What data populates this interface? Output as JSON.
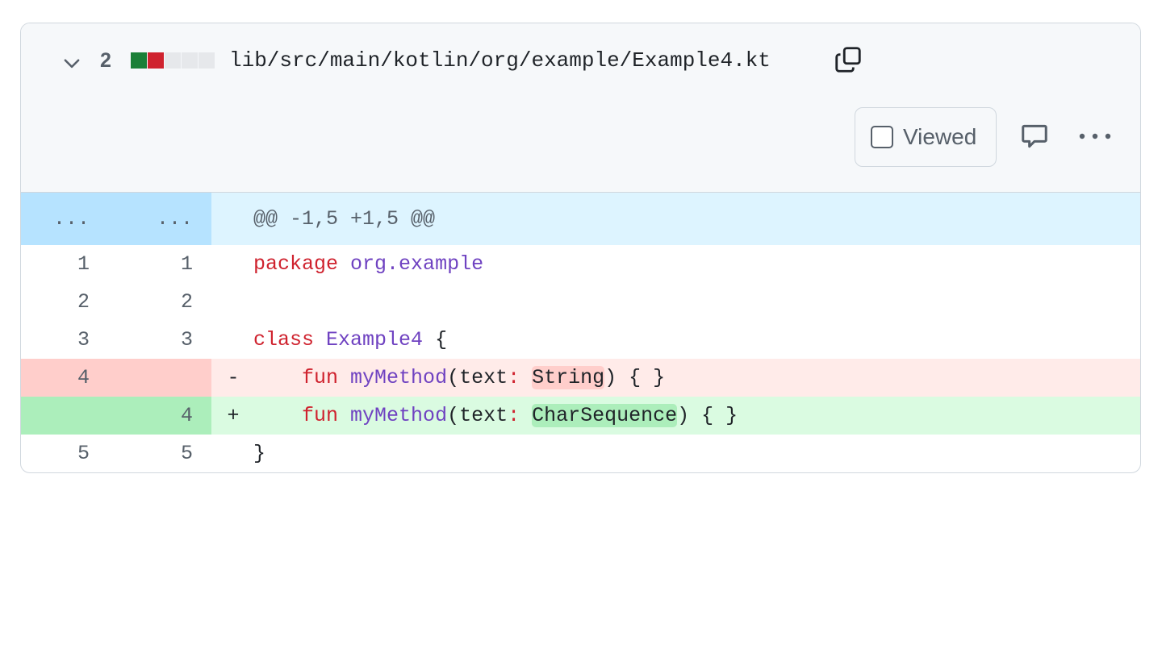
{
  "file_header": {
    "change_count": "2",
    "diffstat": [
      "add",
      "del",
      "neutral",
      "neutral",
      "neutral"
    ],
    "file_path": "lib/src/main/kotlin/org/example/Example4.kt",
    "viewed_label": "Viewed",
    "viewed_checked": false
  },
  "colors": {
    "added": "#1a7f37",
    "deleted": "#cf222e",
    "hunk_bg": "#ddf4ff",
    "keyword": "#cf222e",
    "entity": "#6f42c1"
  },
  "diff": {
    "hunk": {
      "old_ln": "...",
      "new_ln": "...",
      "header": "@@ -1,5 +1,5 @@"
    },
    "lines": [
      {
        "old": "1",
        "new": "1",
        "marker": "",
        "kw": "package",
        "sp": " ",
        "ent": "org.example",
        "rest": ""
      },
      {
        "old": "2",
        "new": "2",
        "marker": "",
        "kw": "",
        "sp": "",
        "ent": "",
        "rest": ""
      },
      {
        "old": "3",
        "new": "3",
        "marker": "",
        "kw": "class",
        "sp": " ",
        "ent": "Example4",
        "rest": " {"
      },
      {
        "old": "4",
        "new": "",
        "marker": "-",
        "indent": "    ",
        "kw": "fun",
        "sp": " ",
        "ent": "myMethod",
        "pre": "(text",
        "colon": ":",
        "mid": " ",
        "hl": "String",
        "post": ") { }"
      },
      {
        "old": "",
        "new": "4",
        "marker": "+",
        "indent": "    ",
        "kw": "fun",
        "sp": " ",
        "ent": "myMethod",
        "pre": "(text",
        "colon": ":",
        "mid": " ",
        "hl": "CharSequence",
        "post": ") { }"
      },
      {
        "old": "5",
        "new": "5",
        "marker": "",
        "rest": "}"
      }
    ]
  }
}
